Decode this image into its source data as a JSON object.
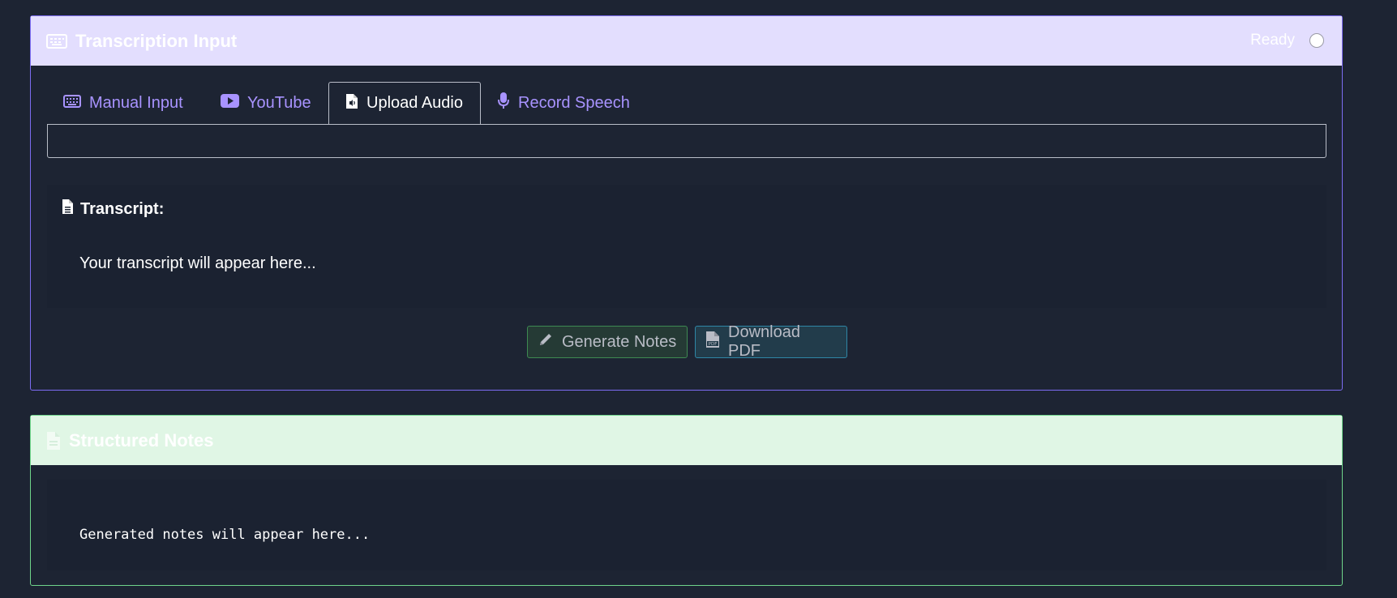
{
  "input_card": {
    "title": "Transcription Input",
    "title_icon": "keyboard-icon",
    "status": "Ready",
    "tabs": [
      {
        "label": "Manual Input",
        "icon": "keyboard-icon"
      },
      {
        "label": "YouTube",
        "icon": "youtube-icon"
      },
      {
        "label": "Upload Audio",
        "icon": "audio-file-icon",
        "active": true
      },
      {
        "label": "Record Speech",
        "icon": "microphone-icon"
      }
    ],
    "transcript_label": "Transcript:",
    "transcript_placeholder": "Your transcript will appear here...",
    "generate_label": "Generate Notes",
    "download_label": "Download PDF"
  },
  "notes_card": {
    "title": "Structured Notes",
    "title_icon": "document-icon",
    "placeholder": "Generated notes will appear here..."
  },
  "colors": {
    "page_bg": "#1d2433",
    "accent_purple": "#7c6cf2",
    "accent_green": "#6fd58b",
    "tab_link": "#a893ff"
  }
}
